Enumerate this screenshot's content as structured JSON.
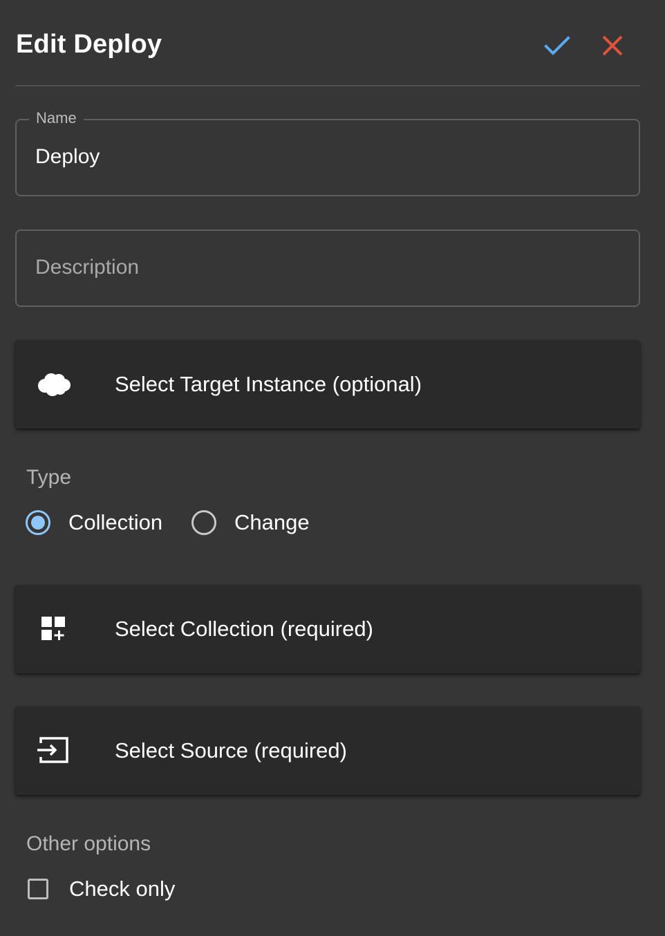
{
  "header": {
    "title": "Edit Deploy",
    "confirm_icon": "check-icon",
    "close_icon": "close-icon",
    "confirm_color": "#5aaaf0",
    "close_color": "#e0533c"
  },
  "form": {
    "name": {
      "label": "Name",
      "value": "Deploy"
    },
    "description": {
      "placeholder": "Description"
    },
    "target_instance": {
      "icon": "cloud-icon",
      "label": "Select Target Instance (optional)"
    },
    "type": {
      "label": "Type",
      "options": [
        {
          "label": "Collection",
          "selected": true
        },
        {
          "label": "Change",
          "selected": false
        }
      ]
    },
    "collection": {
      "icon": "add-widget-icon",
      "label": "Select Collection (required)"
    },
    "source": {
      "icon": "input-icon",
      "label": "Select Source (required)"
    },
    "other_options": {
      "label": "Other options",
      "check_only": {
        "label": "Check only",
        "checked": false
      }
    }
  },
  "colors": {
    "background": "#363636",
    "card": "#2a2a2a",
    "accent": "#8ec6f7"
  }
}
